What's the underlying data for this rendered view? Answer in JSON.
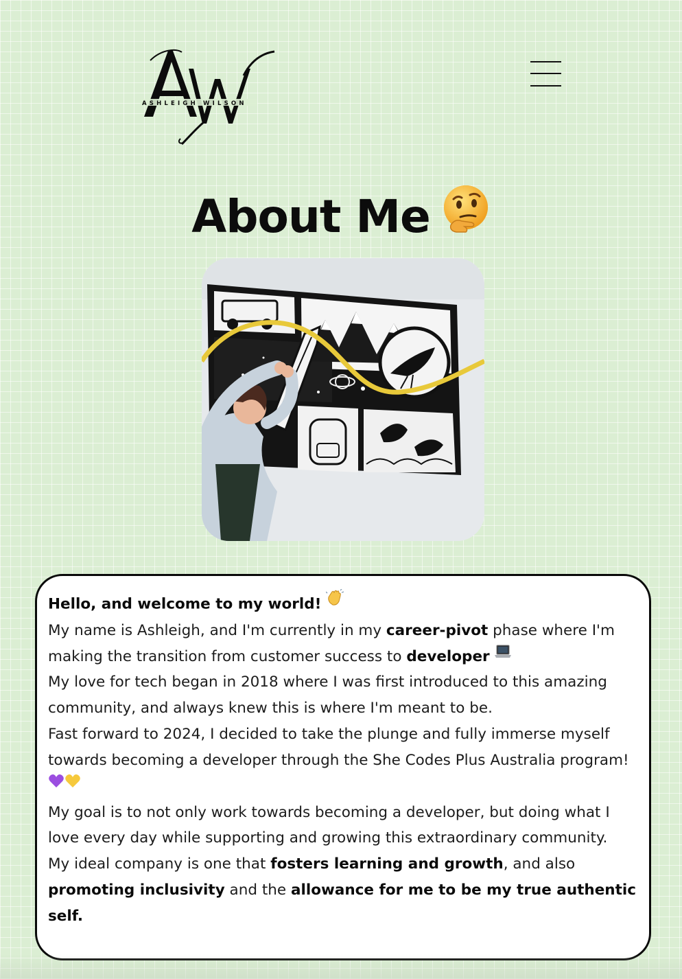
{
  "header": {
    "logo_name": "ASHLEIGH WILSON",
    "logo_monogram": "AW",
    "menu_icon": "hamburger-menu-icon"
  },
  "about": {
    "title": "About Me",
    "title_emoji": "thinking-face-icon",
    "photo_alt": "Ashleigh posing in front of a mural"
  },
  "card": {
    "greeting": "Hello, and welcome to my world!",
    "p2_a": "My name is Ashleigh, and I'm currently in my ",
    "p2_b": "career-pivot",
    "p2_c": " phase where I'm making the transition from customer success to ",
    "p2_d": "developer",
    "p3": "My love for tech began in 2018 where I was first introduced to this amazing community, and always knew this is where I'm meant to be.",
    "p4": "Fast forward to 2024, I decided to take the plunge and fully immerse myself towards becoming a developer through the She Codes Plus Australia program!",
    "p5": "My goal is to not only work towards becoming a developer, but doing what I love every day while supporting and growing this extraordinary community.",
    "p6_a": "My ideal company is one that ",
    "p6_b": "fosters learning and growth",
    "p6_c": ", and also ",
    "p6_d": "promoting inclusivity",
    "p6_e": " and the ",
    "p6_f": "allowance for me to be my true authentic self."
  },
  "colors": {
    "background": "#dbeed3",
    "card": "#ffffff",
    "text": "#111111",
    "accent_yellow": "#e8c93a"
  }
}
